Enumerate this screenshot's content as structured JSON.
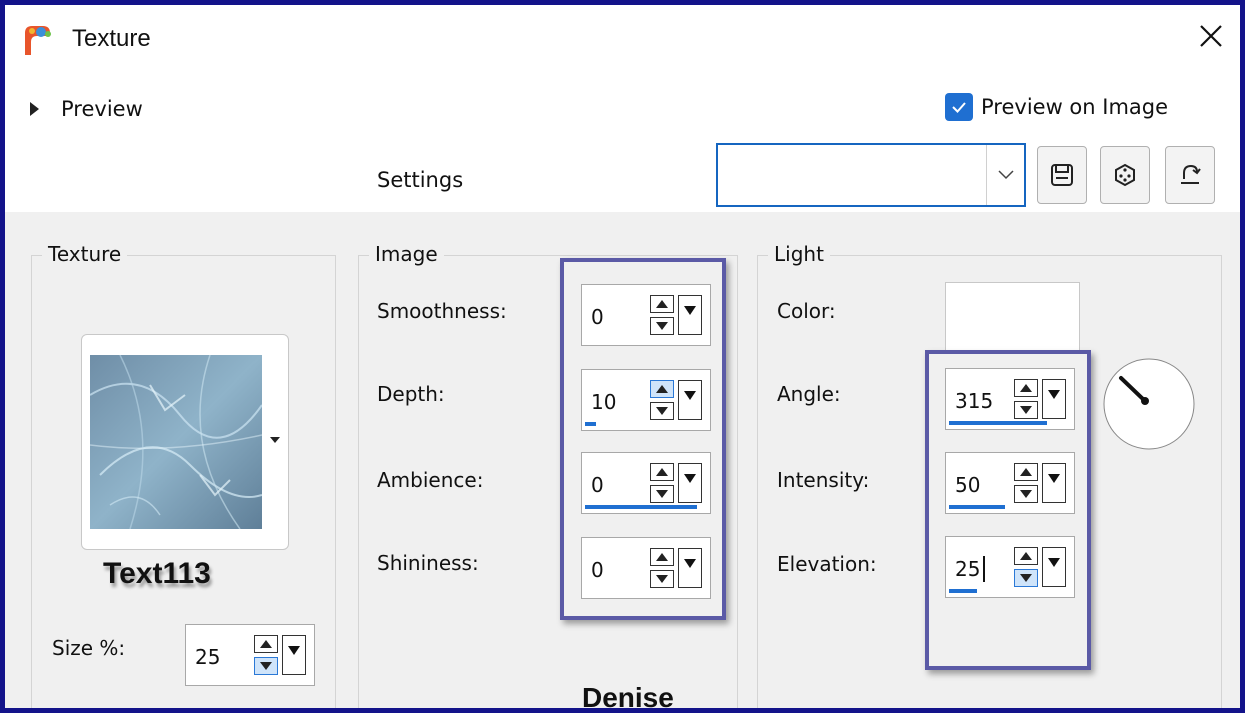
{
  "window": {
    "title": "Texture"
  },
  "preview": {
    "label": "Preview"
  },
  "preview_on_image": {
    "label": "Preview on Image",
    "checked": true
  },
  "settings": {
    "label": "Settings",
    "value": ""
  },
  "texture_group": {
    "title": "Texture",
    "texture_name": "Text113",
    "size_label": "Size %:",
    "size_value": "25"
  },
  "image_group": {
    "title": "Image",
    "fields": [
      {
        "label": "Smoothness:",
        "value": "0",
        "level": 0
      },
      {
        "label": "Depth:",
        "value": "10",
        "level": 0.1
      },
      {
        "label": "Ambience:",
        "value": "0",
        "level": 1.0
      },
      {
        "label": "Shininess:",
        "value": "0",
        "level": 0
      }
    ]
  },
  "light_group": {
    "title": "Light",
    "color_label": "Color:",
    "color_value": "#ffffff",
    "fields": [
      {
        "label": "Angle:",
        "value": "315",
        "level": 0.875
      },
      {
        "label": "Intensity:",
        "value": "50",
        "level": 0.5
      },
      {
        "label": "Elevation:",
        "value": "25",
        "level": 0.25
      }
    ]
  },
  "watermark": "Denise",
  "colors": {
    "accent": "#1f6fd1",
    "border": "#13138a",
    "highlight": "#5b5aa6"
  }
}
